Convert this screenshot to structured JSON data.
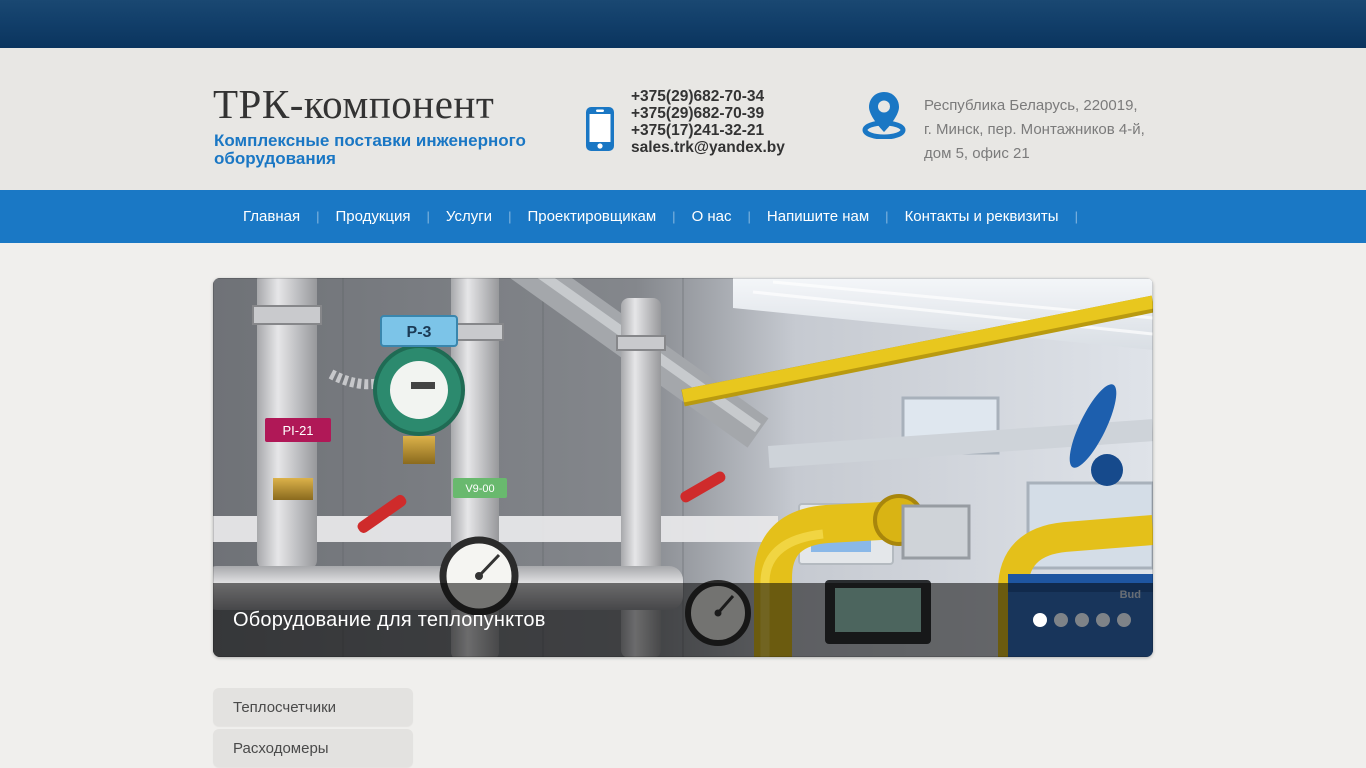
{
  "header": {
    "logo": "ТРК-компонент",
    "tagline": [
      "Комплексные поставки инженерного",
      "оборудования"
    ],
    "contact": {
      "phones": [
        "+375(29)682-70-34",
        "+375(29)682-70-39",
        "+375(17)241-32-21"
      ],
      "email": "sales.trk@yandex.by"
    },
    "address": [
      "Республика Беларусь, 220019,",
      "г. Минск, пер. Монтажников 4-й,",
      "дом 5, офис 21"
    ]
  },
  "nav": {
    "divider": "|",
    "items": [
      "Главная",
      "Продукция",
      "Услуги",
      "Проектировщикам",
      "О нас",
      "Напишите нам",
      "Контакты и реквизиты"
    ]
  },
  "slider": {
    "caption": "Оборудование для теплопунктов",
    "dots_total": 5,
    "active_dot": 1,
    "photo_labels": {
      "pump_tag": "Р-3",
      "pressure_tag": "PI-21",
      "valve_tag": "V9-00",
      "equipment_brand": "Bud"
    }
  },
  "sidebar": {
    "items": [
      "Теплосчетчики",
      "Расходомеры"
    ]
  },
  "colors": {
    "topbar_top": "#1a4872",
    "topbar_bottom": "#0a345e",
    "nav_blue": "#1a78c5",
    "accent_blue": "#1a77c4",
    "header_bg": "#e8e7e4",
    "page_bg": "#f0efed",
    "text_dark": "#333333",
    "text_grey": "#7b7b7b",
    "button_bg": "#e3e2e0",
    "button_text": "#4a4a4a",
    "caption_overlay": "rgba(8,8,8,0.55)"
  }
}
